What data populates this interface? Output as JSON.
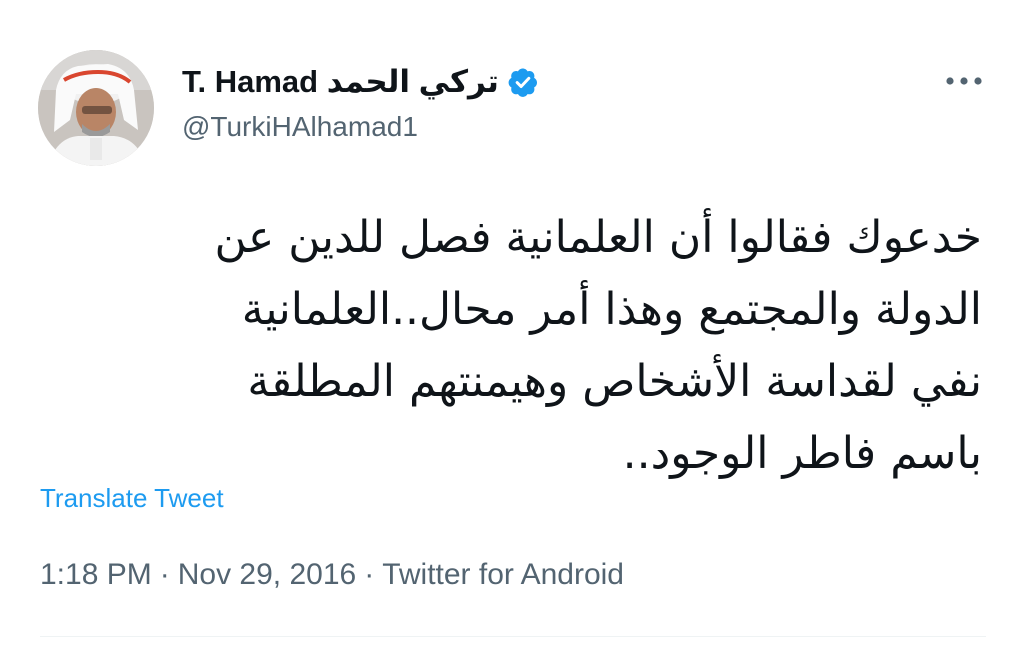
{
  "user": {
    "display_name": "T. Hamad تركي الحمد",
    "handle": "@TurkiHAlhamad1",
    "verified_icon": "verified-badge-icon"
  },
  "menu": {
    "icon": "more-horizontal-icon"
  },
  "tweet": {
    "lines": [
      "خدعوك فقالوا أن العلمانية فصل للدين عن",
      "الدولة والمجتمع وهذا أمر محال..العلمانية",
      "نفي لقداسة الأشخاص وهيمنتهم المطلقة",
      "باسم فاطر الوجود.."
    ]
  },
  "translate_label": "Translate Tweet",
  "meta": {
    "time": "1:18 PM",
    "date": "Nov 29, 2016",
    "source": "Twitter for Android",
    "separator": "·"
  },
  "colors": {
    "accent": "#1d9bf0",
    "secondary_text": "#536471",
    "divider": "#eff3f4"
  }
}
